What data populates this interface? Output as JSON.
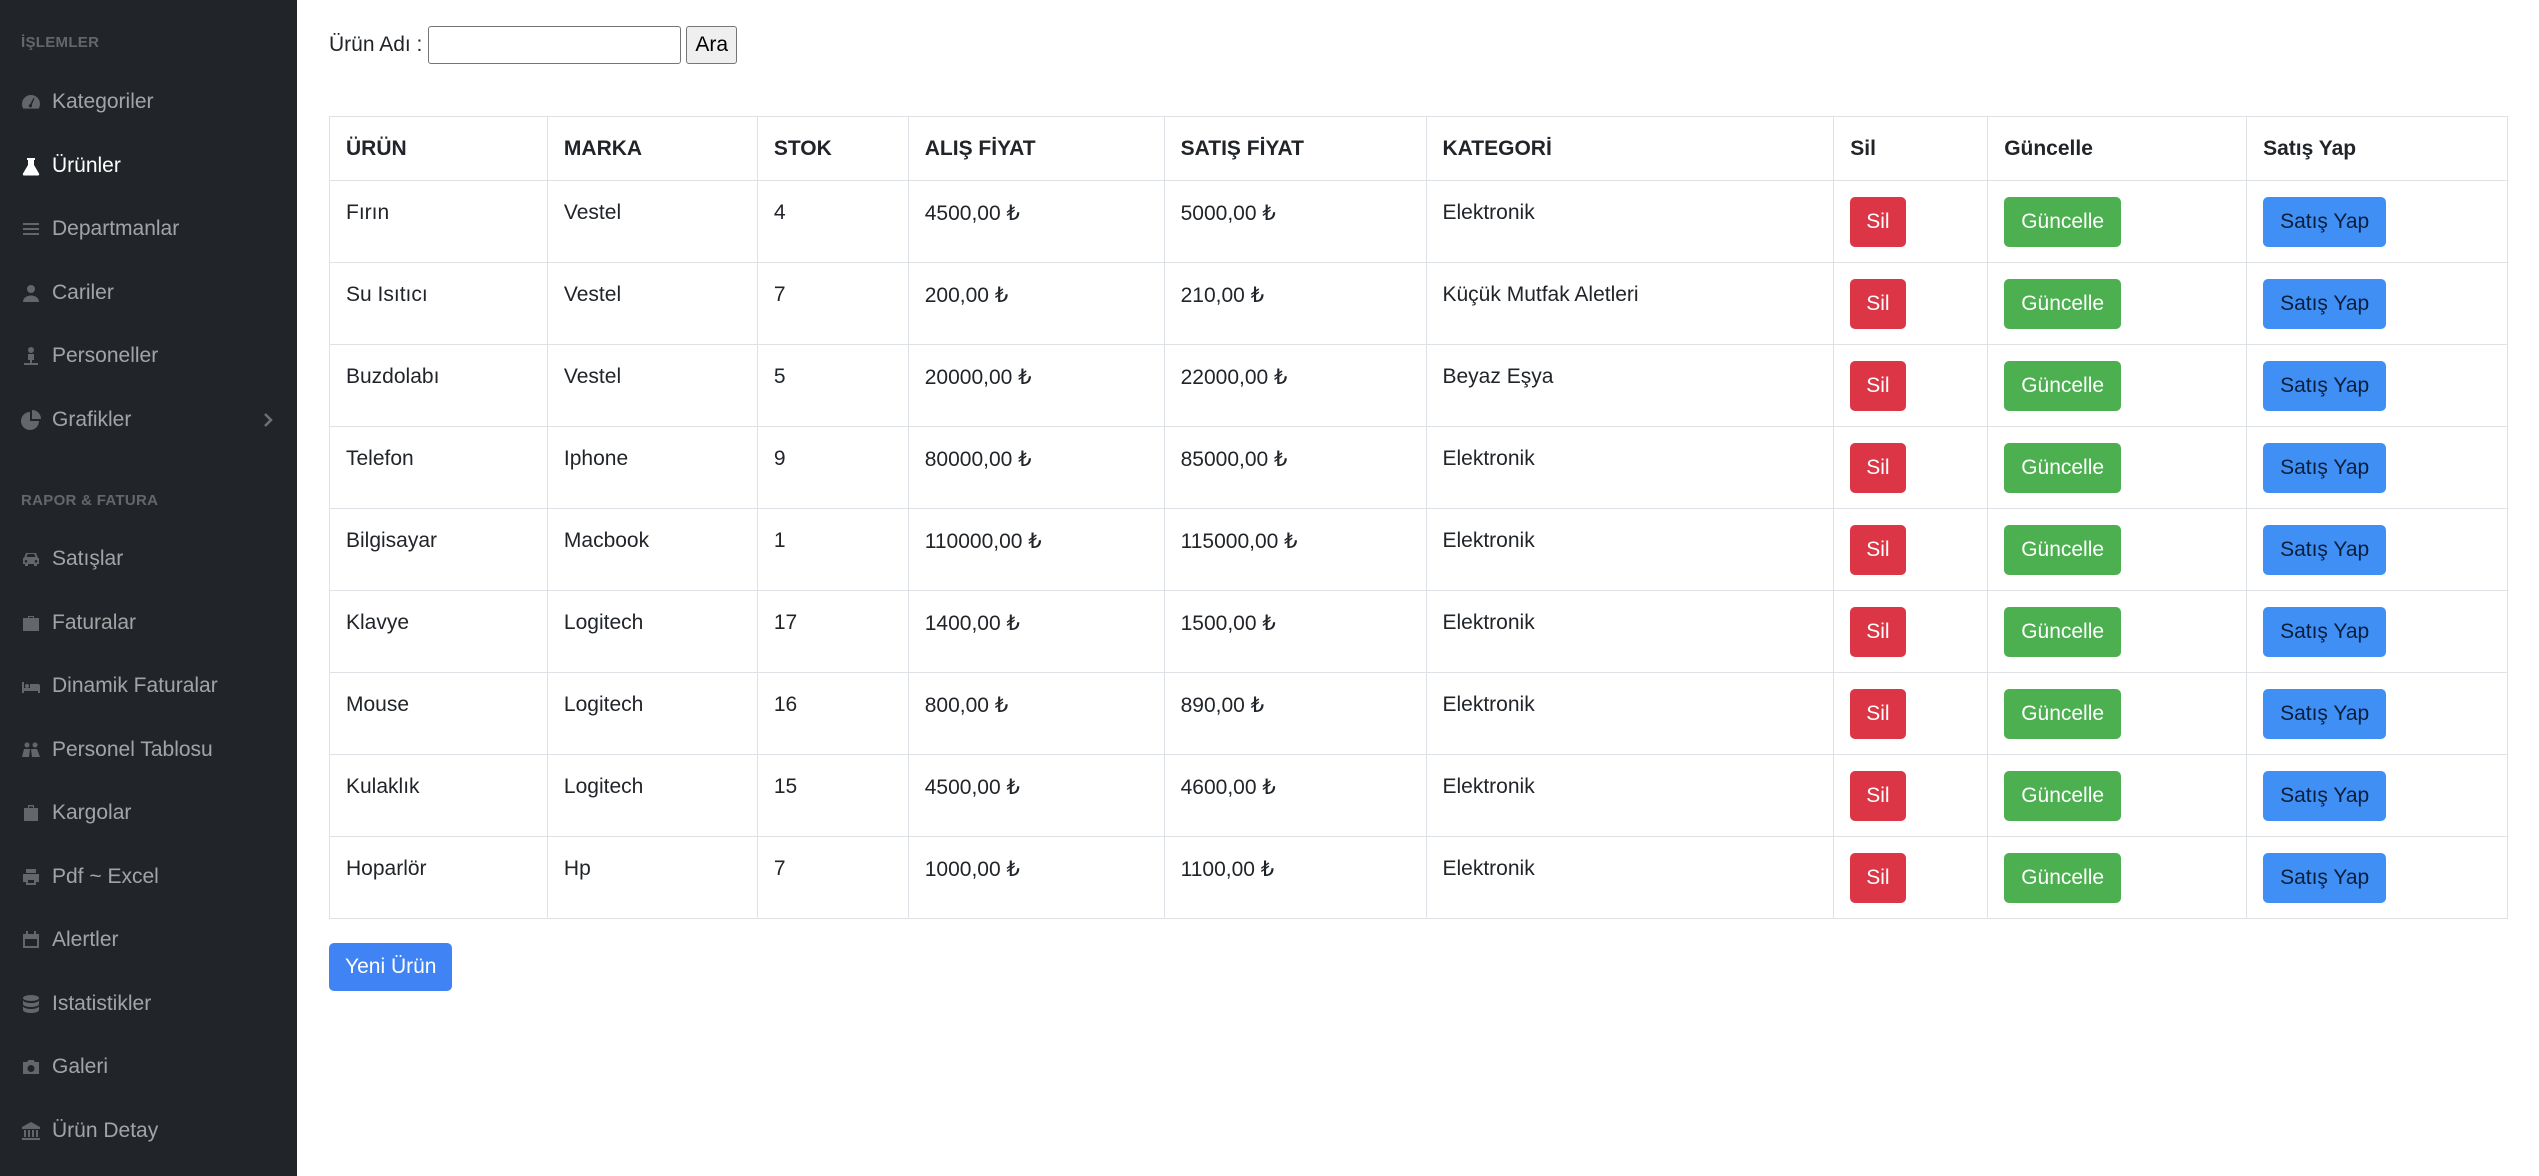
{
  "sidebar": {
    "section1": "İŞLEMLER",
    "section2": "RAPOR & FATURA",
    "items1": [
      {
        "label": "Kategoriler",
        "icon": "dashboard-icon"
      },
      {
        "label": "Ürünler",
        "icon": "flask-icon",
        "active": true
      },
      {
        "label": "Departmanlar",
        "icon": "list-icon"
      },
      {
        "label": "Cariler",
        "icon": "user-icon"
      },
      {
        "label": "Personeller",
        "icon": "person-icon"
      },
      {
        "label": "Grafikler",
        "icon": "pie-chart-icon"
      }
    ],
    "items2": [
      {
        "label": "Satışlar",
        "icon": "car-icon"
      },
      {
        "label": "Faturalar",
        "icon": "briefcase-icon"
      },
      {
        "label": "Dinamik Faturalar",
        "icon": "bed-icon"
      },
      {
        "label": "Personel Tablosu",
        "icon": "people-icon"
      },
      {
        "label": "Kargolar",
        "icon": "suitcase-icon"
      },
      {
        "label": "Pdf ~ Excel",
        "icon": "print-icon"
      },
      {
        "label": "Alertler",
        "icon": "calendar-icon"
      },
      {
        "label": "Istatistikler",
        "icon": "database-icon"
      },
      {
        "label": "Galeri",
        "icon": "camera-icon"
      },
      {
        "label": "Ürün Detay",
        "icon": "bank-icon"
      }
    ]
  },
  "search": {
    "label": "Ürün Adı :",
    "value": "",
    "button": "Ara"
  },
  "table": {
    "headers": [
      "ÜRÜN",
      "MARKA",
      "STOK",
      "ALIŞ FİYAT",
      "SATIŞ FİYAT",
      "KATEGORİ",
      "Sil",
      "Güncelle",
      "Satış Yap"
    ],
    "rows": [
      [
        "Fırın",
        "Vestel",
        "4",
        "4500,00 ₺",
        "5000,00 ₺",
        "Elektronik"
      ],
      [
        "Su Isıtıcı",
        "Vestel",
        "7",
        "200,00 ₺",
        "210,00 ₺",
        "Küçük Mutfak Aletleri"
      ],
      [
        "Buzdolabı",
        "Vestel",
        "5",
        "20000,00 ₺",
        "22000,00 ₺",
        "Beyaz Eşya"
      ],
      [
        "Telefon",
        "Iphone",
        "9",
        "80000,00 ₺",
        "85000,00 ₺",
        "Elektronik"
      ],
      [
        "Bilgisayar",
        "Macbook",
        "1",
        "110000,00 ₺",
        "115000,00 ₺",
        "Elektronik"
      ],
      [
        "Klavye",
        "Logitech",
        "17",
        "1400,00 ₺",
        "1500,00 ₺",
        "Elektronik"
      ],
      [
        "Mouse",
        "Logitech",
        "16",
        "800,00 ₺",
        "890,00 ₺",
        "Elektronik"
      ],
      [
        "Kulaklık",
        "Logitech",
        "15",
        "4500,00 ₺",
        "4600,00 ₺",
        "Elektronik"
      ],
      [
        "Hoparlör",
        "Hp",
        "7",
        "1000,00 ₺",
        "1100,00 ₺",
        "Elektronik"
      ]
    ],
    "delete_label": "Sil",
    "update_label": "Güncelle",
    "sell_label": "Satış Yap"
  },
  "new_button": "Yeni Ürün",
  "colors": {
    "sidebar_bg": "#212529",
    "danger": "#dc3545",
    "success": "#4caf50",
    "primary": "#3f8ff5"
  }
}
